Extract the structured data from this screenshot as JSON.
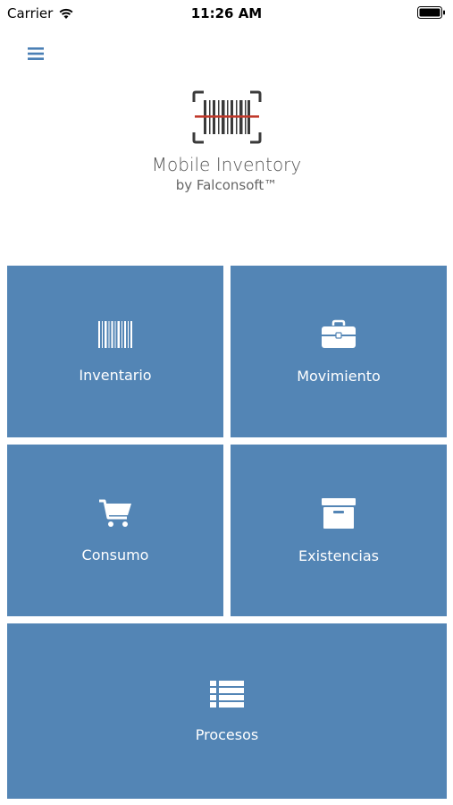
{
  "status_bar": {
    "carrier": "Carrier",
    "time": "11:26 AM"
  },
  "header": {
    "menu_icon": "hamburger-menu-icon"
  },
  "logo": {
    "icon": "barcode-scanner-icon",
    "title": "Mobile Inventory",
    "subtitle": "by Falconsoft™"
  },
  "tiles": [
    {
      "label": "Inventario",
      "icon": "barcode-icon"
    },
    {
      "label": "Movimiento",
      "icon": "briefcase-icon"
    },
    {
      "label": "Consumo",
      "icon": "shopping-cart-icon"
    },
    {
      "label": "Existencias",
      "icon": "archive-box-icon"
    },
    {
      "label": "Procesos",
      "icon": "list-icon"
    }
  ],
  "colors": {
    "tile_background": "#5385b5",
    "accent": "#4a7fb5",
    "scan_line": "#c0392b"
  }
}
